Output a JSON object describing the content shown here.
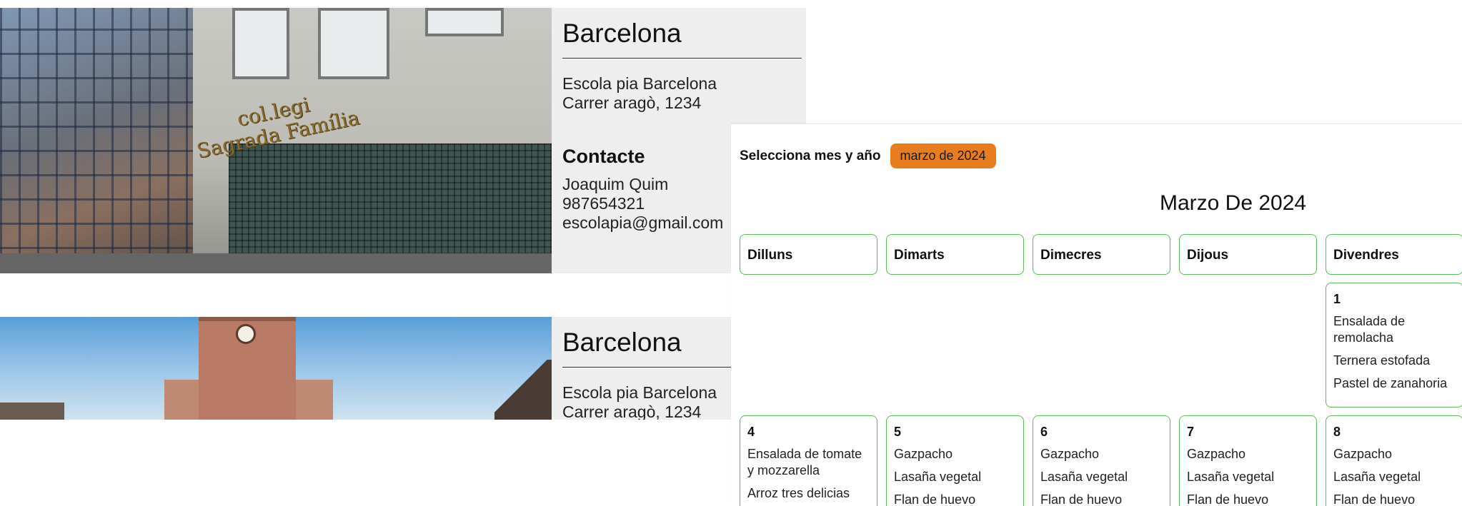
{
  "schools": [
    {
      "city": "Barcelona",
      "name": "Escola pia Barcelona",
      "address": "Carrer aragò, 1234",
      "contact_title": "Contacte",
      "contact_name": "Joaquim Quim",
      "phone": "987654321",
      "email": "escolapia@gmail.com",
      "photo_sign": [
        "col.legi",
        "Sagrada Família"
      ]
    },
    {
      "city": "Barcelona",
      "name": "Escola pia Barcelona",
      "address": "Carrer aragò, 1234"
    }
  ],
  "calendar": {
    "picker_label": "Selecciona mes y año",
    "selected_month": "marzo de 2024",
    "title": "Marzo De 2024",
    "accent_color": "#e87d1e",
    "border_color": "#5cb85c",
    "weekdays": [
      "Dilluns",
      "Dimarts",
      "Dimecres",
      "Dijous",
      "Divendres"
    ],
    "week1": {
      "friday": {
        "day": "1",
        "dishes": [
          "Ensalada de remolacha",
          "Ternera estofada",
          "Pastel de zanahoria"
        ]
      }
    },
    "week2": [
      {
        "day": "4",
        "dishes": [
          "Ensalada de tomate y mozzarella",
          "Arroz tres delicias"
        ]
      },
      {
        "day": "5",
        "dishes": [
          "Gazpacho",
          "Lasaña vegetal",
          "Flan de huevo"
        ]
      },
      {
        "day": "6",
        "dishes": [
          "Gazpacho",
          "Lasaña vegetal",
          "Flan de huevo"
        ]
      },
      {
        "day": "7",
        "dishes": [
          "Gazpacho",
          "Lasaña vegetal",
          "Flan de huevo"
        ]
      },
      {
        "day": "8",
        "dishes": [
          "Gazpacho",
          "Lasaña vegetal",
          "Flan de huevo"
        ]
      }
    ]
  }
}
